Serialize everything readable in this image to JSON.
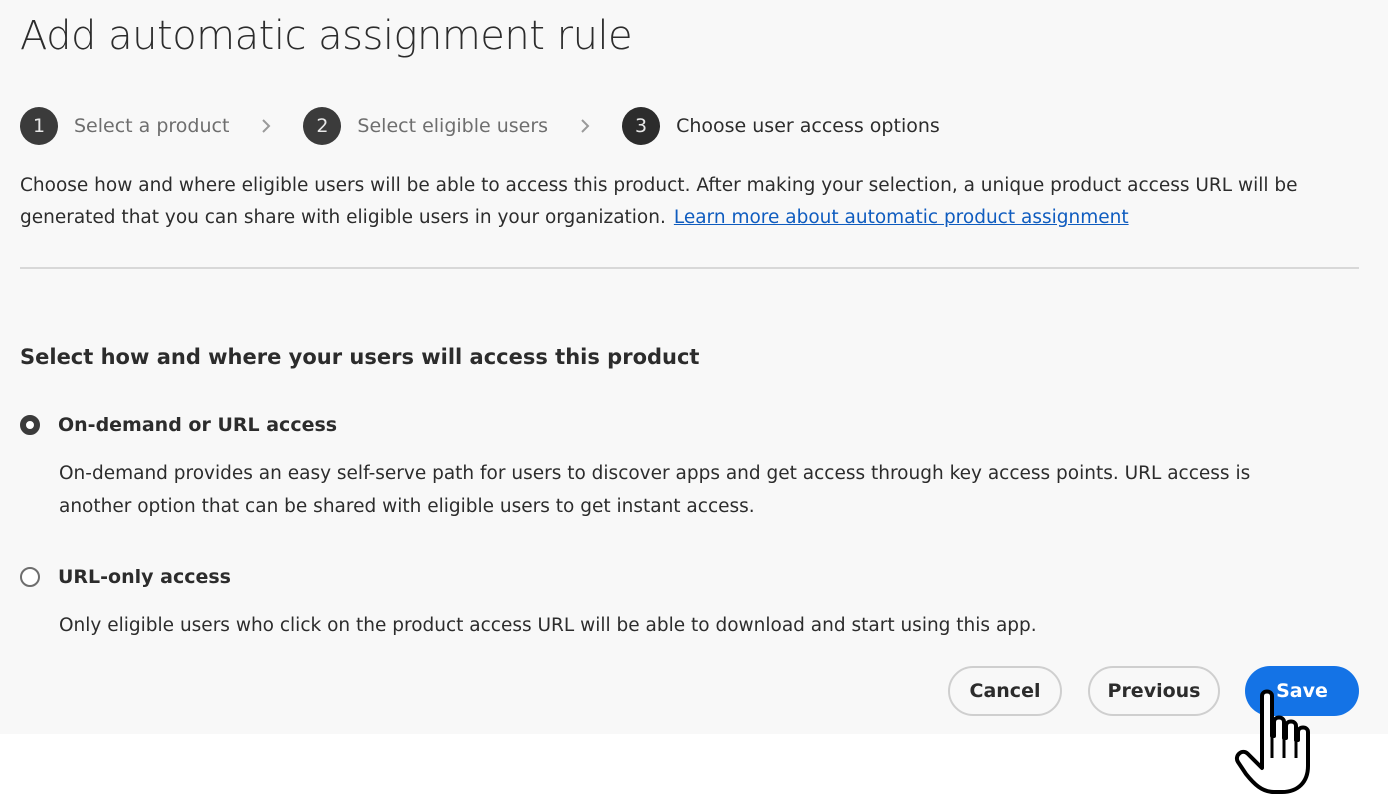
{
  "dialog": {
    "title": "Add automatic assignment rule"
  },
  "stepper": {
    "steps": [
      {
        "number": "1",
        "label": "Select a product",
        "state": "completed"
      },
      {
        "number": "2",
        "label": "Select eligible users",
        "state": "completed"
      },
      {
        "number": "3",
        "label": "Choose user access options",
        "state": "current"
      }
    ],
    "separator_icon": "chevron-right-icon"
  },
  "description": {
    "text": "Choose how and where eligible users will be able to access this product. After making your selection, a unique product access URL will be generated that you can share with eligible users in your organization.",
    "link_text": "Learn more about automatic product assignment"
  },
  "access_section": {
    "heading": "Select how and where your users will access this product",
    "options": [
      {
        "label": "On-demand or URL access",
        "description": "On-demand provides an easy self-serve path for users to discover apps and get access through key access points. URL access is another option that can be shared with eligible users to get instant access.",
        "selected": true
      },
      {
        "label": "URL-only access",
        "description": "Only eligible users who click on the product access URL will be able to download and start using this app.",
        "selected": false
      }
    ]
  },
  "footer": {
    "cancel_label": "Cancel",
    "previous_label": "Previous",
    "save_label": "Save"
  },
  "colors": {
    "background": "#f8f8f8",
    "primary_button": "#1473e6",
    "link": "#0f5cbf",
    "step_badge": "#3b3b3b"
  },
  "cursor": "hand-pointer-icon"
}
